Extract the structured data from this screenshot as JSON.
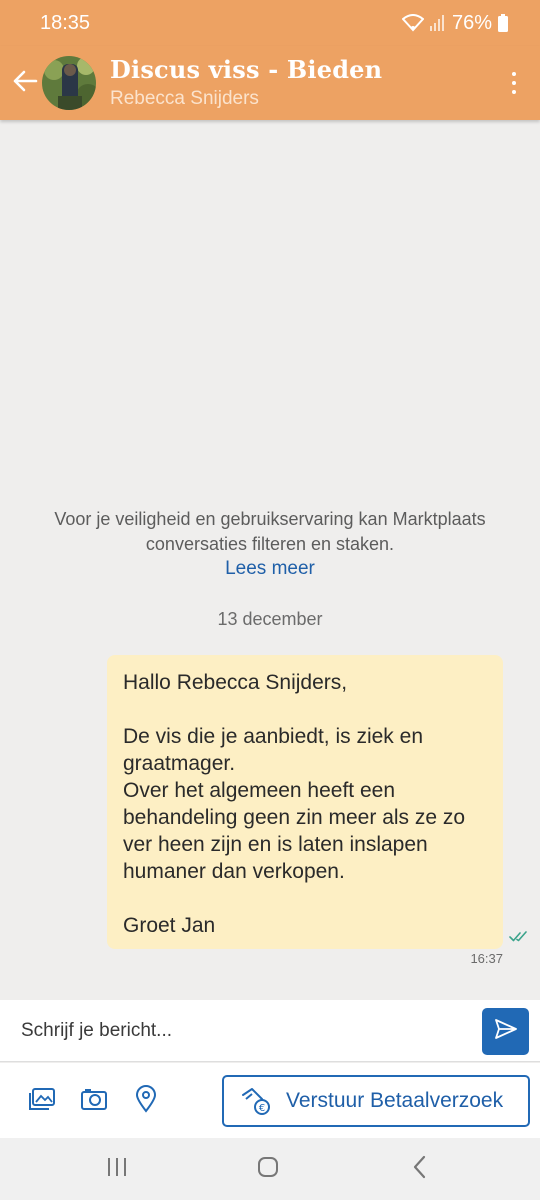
{
  "status": {
    "time": "18:35",
    "battery": "76%"
  },
  "header": {
    "title": "Discus viss - Bieden",
    "subtitle": "Rebecca Snijders"
  },
  "notice": {
    "line1": "Voor je veiligheid en gebruikservaring kan Marktplaats",
    "line2": "conversaties filteren en staken.",
    "link": "Lees meer"
  },
  "date_separator": "13 december",
  "message": {
    "text": "Hallo Rebecca Snijders,\n\nDe vis die je aanbiedt, is ziek en graatmager.\nOver het algemeen heeft een behandeling geen zin meer als ze zo ver heen zijn en is laten inslapen humaner dan verkopen.\n\nGroet Jan",
    "time": "16:37",
    "status": "read"
  },
  "composer": {
    "placeholder": "Schrijf je bericht..."
  },
  "toolbar": {
    "payment_label": "Verstuur Betaalverzoek"
  },
  "colors": {
    "brand_orange": "#eda263",
    "accent_blue": "#2169b5",
    "bubble": "#fdefc4"
  }
}
